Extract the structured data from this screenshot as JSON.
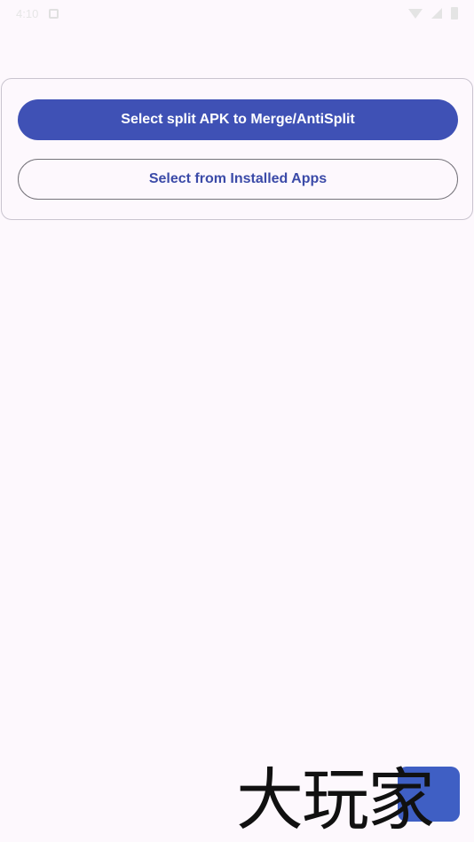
{
  "status_bar": {
    "time": "4:10"
  },
  "card": {
    "primary_button_label": "Select split APK to Merge/AntiSplit",
    "secondary_button_label": "Select from Installed Apps"
  },
  "watermark": {
    "text": "大玩家",
    "badge_color": "#3f5fc4"
  },
  "colors": {
    "primary": "#3f51b5",
    "outline_text": "#3b4aa8",
    "background": "#fdf8fd",
    "card_border": "#c9c4cf"
  }
}
